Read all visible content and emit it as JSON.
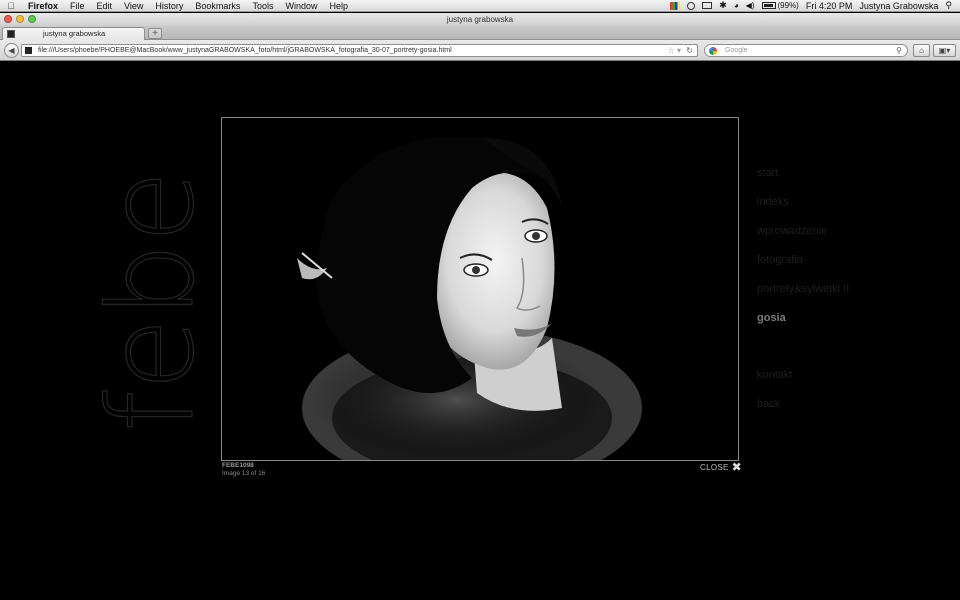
{
  "menubar": {
    "app": "Firefox",
    "items": [
      "File",
      "Edit",
      "View",
      "History",
      "Bookmarks",
      "Tools",
      "Window",
      "Help"
    ],
    "battery": "(99%)",
    "clock": "Fri 4:20 PM",
    "user": "Justyna Grabowska"
  },
  "window": {
    "title": "justyna grabowska"
  },
  "tabs": [
    {
      "label": "justyna grabowska"
    }
  ],
  "navbar": {
    "url": "file:///Users/phoebe/PHOEBE@MacBook/www_justynaGRABOWSKA_foto/html/jGRABOWSKA_fotografia_30-07_portrety-gosia.html",
    "search_placeholder": "Google"
  },
  "gallery": {
    "logo_text": "febe",
    "photo_code": "FEBE1098",
    "counter": "Image 13 of 16",
    "close_label": "CLOSE"
  },
  "nav": {
    "items": [
      {
        "label": "start"
      },
      {
        "label": "indeks"
      },
      {
        "label": "wprowadzenie"
      },
      {
        "label": "fotografia"
      },
      {
        "label": "portrety&sylwetki II"
      },
      {
        "label": "gosia",
        "active": true
      }
    ],
    "secondary": [
      {
        "label": "kontakt"
      },
      {
        "label": "back"
      }
    ]
  },
  "colors": {
    "page_bg": "#000000",
    "nav_text": "#1e1e1e",
    "nav_active": "#7a7a7a",
    "frame_border": "#8a8a8a"
  }
}
